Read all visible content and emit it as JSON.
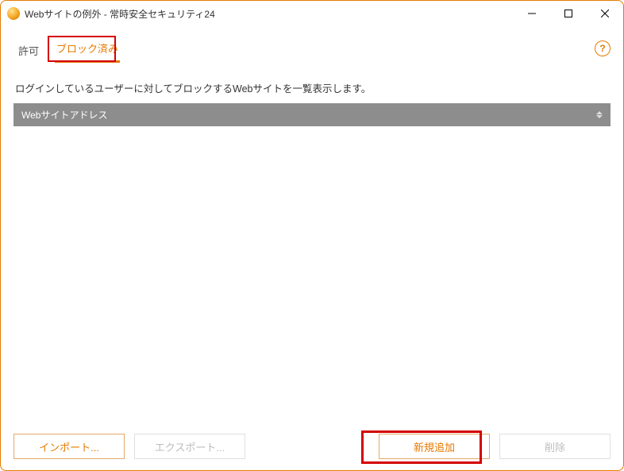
{
  "titlebar": {
    "title": "Webサイトの例外 - 常時安全セキュリティ24"
  },
  "tabs": {
    "allow": "許可",
    "blocked": "ブロック済み"
  },
  "help": {
    "glyph": "?"
  },
  "description": "ログインしているユーザーに対してブロックするWebサイトを一覧表示します。",
  "grid": {
    "col_address": "Webサイトアドレス"
  },
  "buttons": {
    "import": "インポート...",
    "export": "エクスポート...",
    "add": "新規追加",
    "delete": "削除"
  }
}
